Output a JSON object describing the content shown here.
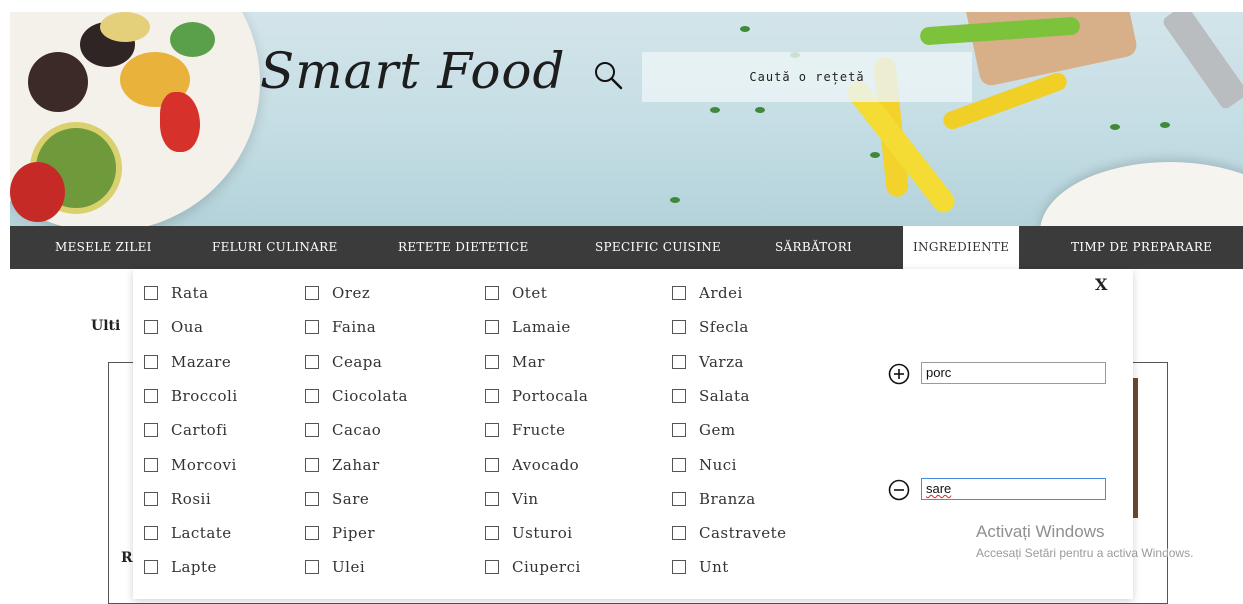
{
  "brand": {
    "logo_text": "Smart Food"
  },
  "search": {
    "placeholder": "Caută o rețetă"
  },
  "nav": {
    "items": [
      {
        "label": "MESELE ZILEI"
      },
      {
        "label": "FELURI CULINARE"
      },
      {
        "label": "RETETE DIETETICE"
      },
      {
        "label": "SPECIFIC CUISINE"
      },
      {
        "label": "SĂRBĂTORI"
      },
      {
        "label": "INGREDIENTE"
      },
      {
        "label": "TIMP DE PREPARARE"
      }
    ],
    "active": "INGREDIENTE"
  },
  "background": {
    "heading_fragment": "Ulti",
    "second_fragment": "R"
  },
  "ingredients": {
    "columns": [
      [
        "Rata",
        "Oua",
        "Mazare",
        "Broccoli",
        "Cartofi",
        "Morcovi",
        "Rosii",
        "Lactate",
        "Lapte"
      ],
      [
        "Orez",
        "Faina",
        "Ceapa",
        "Ciocolata",
        "Cacao",
        "Zahar",
        "Sare",
        "Piper",
        "Ulei"
      ],
      [
        "Otet",
        "Lamaie",
        "Mar",
        "Portocala",
        "Fructe",
        "Avocado",
        "Vin",
        "Usturoi",
        "Ciuperci"
      ],
      [
        "Ardei",
        "Sfecla",
        "Varza",
        "Salata",
        "Gem",
        "Nuci",
        "Branza",
        "Castravete",
        "Unt"
      ]
    ],
    "close_label": "X",
    "include_value": "porc",
    "exclude_value": "sare"
  },
  "watermark": {
    "line1": "Activați Windows",
    "line2": "Accesați Setări pentru a activa Windows."
  },
  "colors": {
    "nav_bg": "#3b3b3b",
    "nav_text": "#ffffff",
    "active_tab_bg": "#ffffff",
    "hero_bg": "#c4dde4"
  }
}
